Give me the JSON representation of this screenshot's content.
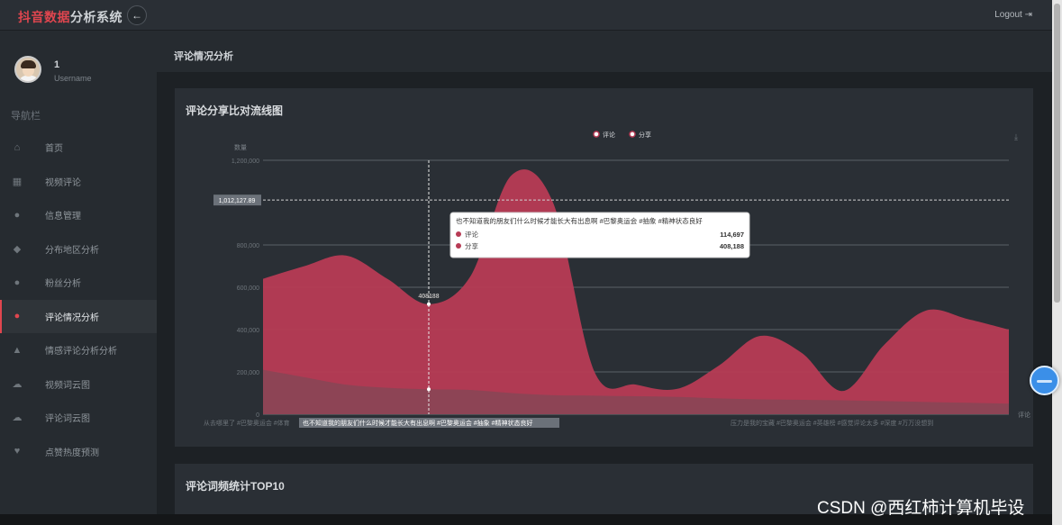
{
  "header": {
    "brand_part1": "抖音数据",
    "brand_part2": "分析系统",
    "toggle_symbol": "←",
    "logout_label": "Logout"
  },
  "user": {
    "name": "1",
    "role": "Username"
  },
  "sidebar": {
    "heading": "导航栏",
    "items": [
      {
        "label": "首页",
        "icon": "home-icon",
        "glyph": "⌂"
      },
      {
        "label": "视频评论",
        "icon": "grid-icon",
        "glyph": "▦"
      },
      {
        "label": "信息管理",
        "icon": "user-icon",
        "glyph": "●"
      },
      {
        "label": "分布地区分析",
        "icon": "map-pin-icon",
        "glyph": "◆"
      },
      {
        "label": "粉丝分析",
        "icon": "users-icon",
        "glyph": "●"
      },
      {
        "label": "评论情况分析",
        "icon": "comment-icon",
        "glyph": "●",
        "active": true
      },
      {
        "label": "情感评论分析分析",
        "icon": "fire-icon",
        "glyph": "▲"
      },
      {
        "label": "视频词云图",
        "icon": "cloud-upload-icon",
        "glyph": "☁"
      },
      {
        "label": "评论词云图",
        "icon": "cloud-download-icon",
        "glyph": "☁"
      },
      {
        "label": "点赞热度预测",
        "icon": "heart-icon",
        "glyph": "♥"
      }
    ]
  },
  "breadcrumb": "评论情况分析",
  "panel": {
    "title": "评论分享比对流线图"
  },
  "panel2": {
    "title": "评论词频统计TOP10"
  },
  "colors": {
    "accent": "#e0464f",
    "series_fill": "#b73b55",
    "background": "#1f2327"
  },
  "watermark": "CSDN @西红柿计算机毕设",
  "chart_data": {
    "type": "area",
    "title": "",
    "ylabel": "数量",
    "xlabel": "评论",
    "ylim": [
      0,
      1200000
    ],
    "yticks": [
      "0",
      "200,000",
      "400,000",
      "600,000",
      "800,000",
      "1,200,000"
    ],
    "yticks_values": [
      0,
      200000,
      400000,
      600000,
      800000,
      1200000
    ],
    "legend": {
      "position": "top-center",
      "entries": [
        "评论",
        "分享"
      ]
    },
    "x_label_left": "从去哪里了 #巴黎奥运会 #体育",
    "x_label_highlight": "也不知道我的朋友们什么时候才能长大有出息啊 #巴黎奥运会 #抽象 #精神状态良好",
    "x_label_right": "压力是我的宝藏 #巴黎奥运会 #英雄榜 #感觉评论太多 #深度 #万万没想到",
    "crosshair_value_label": "1,012,127.89",
    "point_label": "408188",
    "tooltip": {
      "title": "也不知道我的朋友们什么时候才能长大有出息啊 #巴黎奥运会 #抽象 #精神状态良好",
      "rows": [
        {
          "name": "评论",
          "value": "114,697"
        },
        {
          "name": "分享",
          "value": "408,188"
        }
      ]
    },
    "x": [
      0,
      1,
      2,
      3,
      4,
      5,
      6,
      7,
      8,
      9,
      10,
      11,
      12,
      13,
      14,
      15,
      16,
      17,
      18
    ],
    "series": [
      {
        "name": "评论",
        "values": [
          210000,
          175000,
          140000,
          125000,
          118000,
          115000,
          100000,
          90000,
          88000,
          85000,
          82000,
          75000,
          70000,
          68000,
          66000,
          62000,
          58000,
          54000,
          50000
        ]
      },
      {
        "name": "分享",
        "values": [
          640000,
          700000,
          750000,
          640000,
          520000,
          650000,
          1130000,
          1000000,
          200000,
          140000,
          120000,
          230000,
          370000,
          290000,
          110000,
          330000,
          490000,
          450000,
          400000
        ]
      }
    ]
  }
}
